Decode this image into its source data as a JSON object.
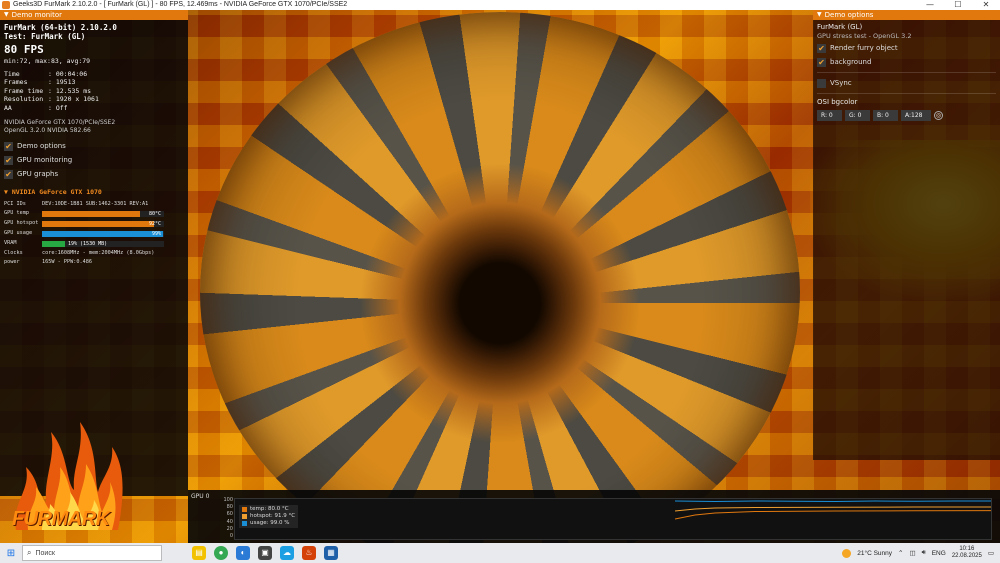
{
  "window": {
    "title": "Geeks3D FurMark 2.10.2.0 - [ FurMark (GL) ] - 80 FPS, 12.469ms - NVIDIA GeForce GTX 1070/PCIe/SSE2"
  },
  "demo_monitor": {
    "header": "Demo monitor",
    "app_name": "FurMark (64-bit) 2.10.2.0",
    "test_name": "Test: FurMark (GL)",
    "fps": "80 FPS",
    "fps_stats": "min:72, max:83, avg:79",
    "stats": [
      {
        "key": "Time",
        "value": ": 00:04:06"
      },
      {
        "key": "Frames",
        "value": ": 19513"
      },
      {
        "key": "Frame time",
        "value": ": 12.535 ms"
      },
      {
        "key": "Resolution",
        "value": ": 1920 x 1061"
      },
      {
        "key": "AA",
        "value": ": Off"
      }
    ],
    "gpu_renderer": "NVIDIA GeForce GTX 1070/PCIe/SSE2",
    "gl_version": "OpenGL 3.2.0 NVIDIA 582.66",
    "checkboxes": [
      {
        "label": "Demo options",
        "checked": true
      },
      {
        "label": "GPU monitoring",
        "checked": true
      },
      {
        "label": "GPU graphs",
        "checked": true
      }
    ],
    "gpu_section": {
      "title": "NVIDIA GeForce GTX 1070",
      "pci_key": "PCI IDs",
      "pci_value": "DEV:10DE-1B81 SUB:1462-3301 REV:A1",
      "bars": [
        {
          "key": "GPU temp",
          "text": "80°C",
          "fill": 0.8,
          "color": "#e0780e"
        },
        {
          "key": "GPU hotspot",
          "text": "92°C",
          "fill": 0.92,
          "color": "#e0780e"
        },
        {
          "key": "GPU usage",
          "text": "99%",
          "fill": 0.99,
          "color": "#1a8fd6"
        },
        {
          "key": "VRAM",
          "text": "19% (1530 MB)",
          "fill": 0.19,
          "color": "#27a843"
        }
      ],
      "clocks_key": "Clocks",
      "clocks_value": "core:1608MHz - mem:2004MHz (8.0Gbps)",
      "power_key": "power",
      "power_value": "165W - PPW:0.486"
    },
    "logo_text": "FURMARK"
  },
  "demo_options": {
    "header": "Demo options",
    "title": "FurMark (GL)",
    "subtitle": "GPU stress test - OpenGL 3.2",
    "checkboxes": [
      {
        "label": "Render furry object",
        "checked": true
      },
      {
        "label": "background",
        "checked": true
      }
    ],
    "vsync": {
      "label": "VSync",
      "checked": false
    },
    "osi_label": "OSI bgcolor",
    "rgba": [
      "R: 0",
      "G: 0",
      "B: 0",
      "A:128"
    ]
  },
  "graph": {
    "label": "GPU 0",
    "y_ticks": [
      "100",
      "80",
      "60",
      "40",
      "20",
      "0"
    ],
    "legend": [
      {
        "label": "temp: 80.0 °C",
        "color": "#e0780e"
      },
      {
        "label": "hotspot: 91.9 °C",
        "color": "#f0a030"
      },
      {
        "label": "usage: 99.0 %",
        "color": "#1a8fd6"
      }
    ]
  },
  "taskbar": {
    "search_placeholder": "Поиск",
    "weather": "21°C Sunny",
    "language": "ENG",
    "time": "10:16",
    "date": "22.08.2025"
  }
}
